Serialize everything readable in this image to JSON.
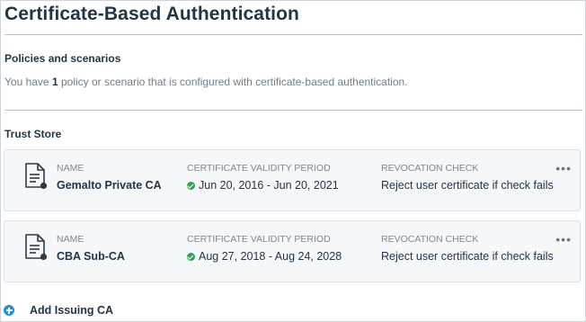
{
  "page": {
    "title": "Certificate-Based Authentication"
  },
  "policies": {
    "heading": "Policies and scenarios",
    "text_prefix": "You have ",
    "count": "1",
    "text_suffix": " policy or scenario that is configured with certificate-based authentication."
  },
  "trust_store": {
    "heading": "Trust Store",
    "labels": {
      "name": "NAME",
      "validity": "CERTIFICATE VALIDITY PERIOD",
      "revocation": "REVOCATION CHECK"
    },
    "items": [
      {
        "name": "Gemalto Private CA",
        "validity": "Jun 20, 2016 - Jun 20, 2021",
        "revocation": "Reject user certificate if check fails",
        "more": "•••"
      },
      {
        "name": "CBA Sub-CA",
        "validity": "Aug 27, 2018 - Aug 24, 2028",
        "revocation": "Reject user certificate if check fails",
        "more": "•••"
      }
    ]
  },
  "add_issuing_ca": {
    "label": "Add Issuing CA"
  },
  "icons": {
    "certificate": "certificate-document-icon",
    "valid": "check-circle-icon",
    "more": "more-dots-icon",
    "add": "plus-circle-icon"
  },
  "colors": {
    "valid": "#2da44e",
    "add": "#1e91d6",
    "heading": "#233547"
  }
}
